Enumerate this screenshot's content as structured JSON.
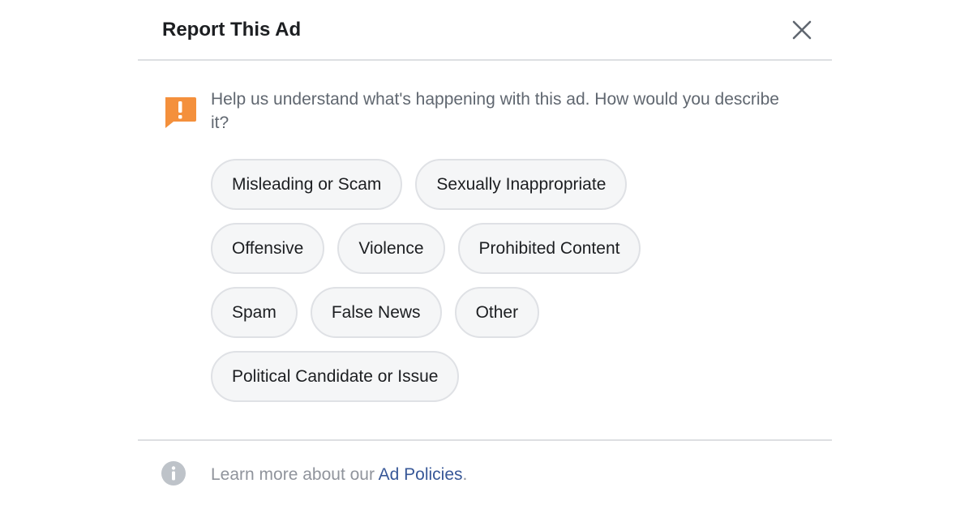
{
  "dialog": {
    "title": "Report This Ad",
    "close_icon": "close-icon"
  },
  "prompt": {
    "icon": "warning-icon",
    "text": "Help us understand what's happening with this ad. How would you describe it?"
  },
  "options": [
    [
      "Misleading or Scam",
      "Sexually Inappropriate"
    ],
    [
      "Offensive",
      "Violence",
      "Prohibited Content"
    ],
    [
      "Spam",
      "False News",
      "Other"
    ],
    [
      "Political Candidate or Issue"
    ]
  ],
  "footer": {
    "icon": "info-icon",
    "text_before": "Learn more about our ",
    "link_label": "Ad Policies",
    "text_after": "."
  },
  "colors": {
    "warning": "#f4903c",
    "link": "#385898",
    "pill_bg": "#f5f6f7"
  }
}
